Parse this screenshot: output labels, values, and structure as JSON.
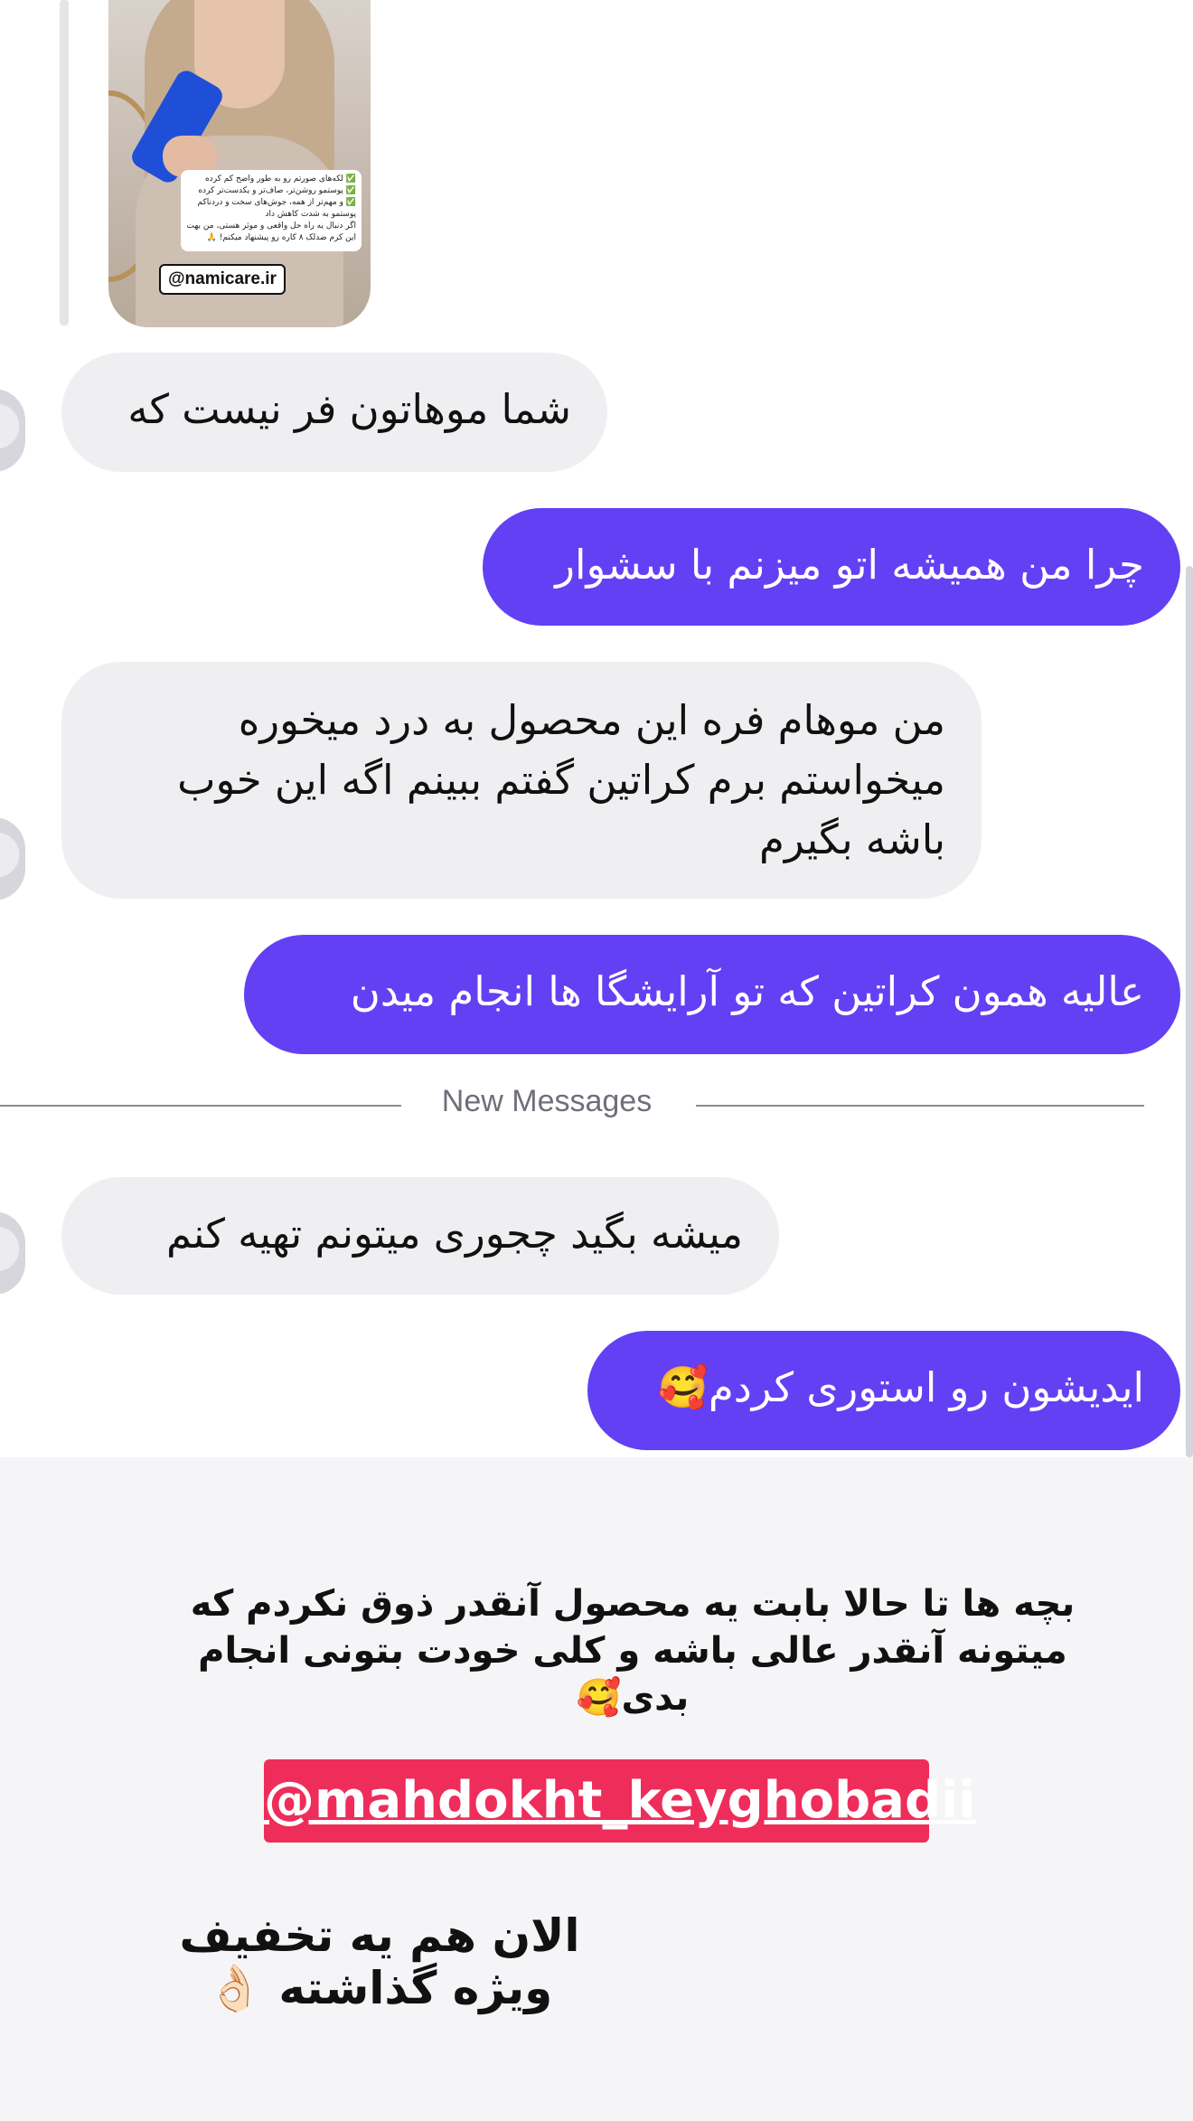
{
  "story": {
    "handle": "@namicare.ir",
    "lines": [
      "✅ لکه‌های صورتم رو به طور واضح کم کرده",
      "✅ پوستمو روشن‌تر، صاف‌تر و یکدست‌تر کرده",
      "✅ و مهم‌تر از همه، جوش‌های سخت و دردناکم",
      "پوستمو به شدت کاهش داد",
      "اگر دنبال یه راه حل واقعی و موثر هستی، من بهت",
      "این کرم ضدلک ۸ کاره رو پیشنهاد میکنم! 🙏"
    ]
  },
  "messages": [
    {
      "side": "in",
      "text": "شما موهاتون فر نیست که"
    },
    {
      "side": "out",
      "text": "چرا من همیشه اتو میزنم با سشوار"
    },
    {
      "side": "in",
      "text": "من موهام فره این محصول به درد میخوره میخواستم برم کراتین گفتم ببینم اگه این خوب باشه بگیرم"
    },
    {
      "side": "out",
      "text": "عالیه  همون کراتین که تو آرایشگا ها انجام میدن"
    },
    {
      "side": "in",
      "text": "میشه بگید چجوری میتونم تهیه کنم"
    },
    {
      "side": "out",
      "text": "ایدیشون رو استوری کردم🥰"
    }
  ],
  "divider": {
    "label": "New Messages"
  },
  "overlay": {
    "caption": "بچه ها تا حالا بابت یه محصول آنقدر ذوق نکردم که میتونه آنقدر عالی باشه و کلی خودت بتونی انجام بدی🥰",
    "mention": "@mahdokht_keyghobadii",
    "discount": "الان هم یه تخفیف ویژه گذاشته 👌🏻"
  },
  "colors": {
    "outgoing": "#6340f4",
    "incoming": "#efeff1",
    "mention_bg": "#ee2d5a"
  }
}
